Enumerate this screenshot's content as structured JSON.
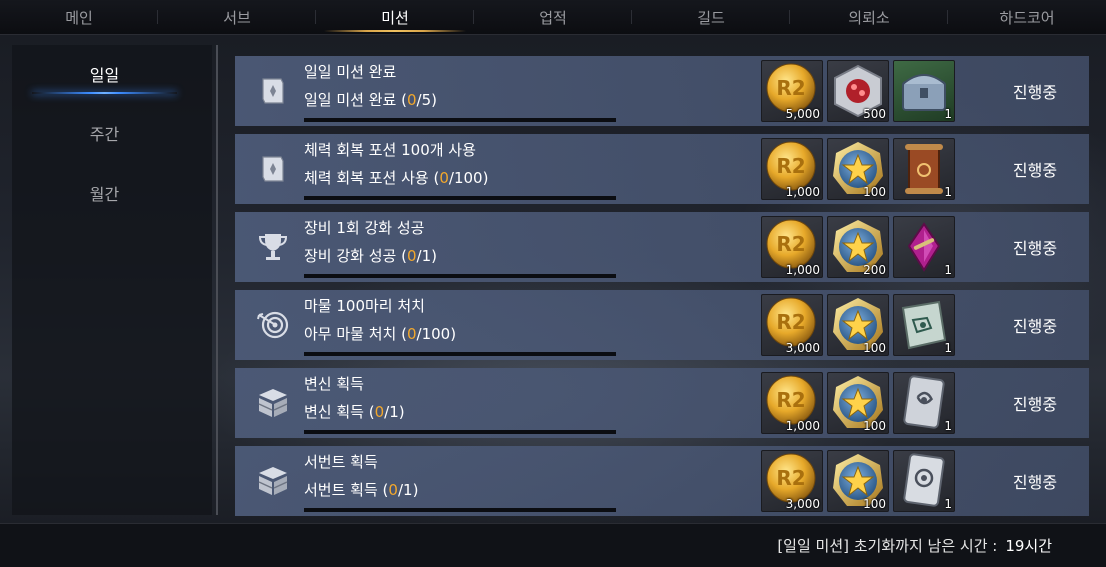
{
  "tabs": [
    {
      "label": "메인",
      "active": false
    },
    {
      "label": "서브",
      "active": false
    },
    {
      "label": "미션",
      "active": true
    },
    {
      "label": "업적",
      "active": false
    },
    {
      "label": "길드",
      "active": false
    },
    {
      "label": "의뢰소",
      "active": false
    },
    {
      "label": "하드코어",
      "active": false
    }
  ],
  "sidebar": {
    "items": [
      {
        "label": "일일",
        "active": true
      },
      {
        "label": "주간",
        "active": false
      },
      {
        "label": "월간",
        "active": false
      }
    ]
  },
  "missions": [
    {
      "icon": "scroll-icon",
      "title": "일일 미션 완료",
      "sub_label": "일일 미션 완료",
      "current": "0",
      "target": "/5",
      "progress": 0,
      "rewards": [
        {
          "icon": "gold-coin-icon",
          "qty": "5,000"
        },
        {
          "icon": "red-gem-icon",
          "qty": "500"
        },
        {
          "icon": "chest-icon",
          "qty": "1"
        }
      ],
      "status": "진행중"
    },
    {
      "icon": "scroll-icon",
      "title": "체력 회복 포션 100개 사용",
      "sub_label": "체력 회복 포션 사용",
      "current": "0",
      "target": "/100",
      "progress": 0,
      "rewards": [
        {
          "icon": "gold-coin-icon",
          "qty": "1,000"
        },
        {
          "icon": "star-medal-icon",
          "qty": "100"
        },
        {
          "icon": "red-scroll-icon",
          "qty": "1"
        }
      ],
      "status": "진행중"
    },
    {
      "icon": "trophy-icon",
      "title": "장비 1회 강화 성공",
      "sub_label": "장비 강화 성공",
      "current": "0",
      "target": "/1",
      "progress": 0,
      "rewards": [
        {
          "icon": "gold-coin-icon",
          "qty": "1,000"
        },
        {
          "icon": "star-medal-icon",
          "qty": "200"
        },
        {
          "icon": "potion-icon",
          "qty": "1"
        }
      ],
      "status": "진행중"
    },
    {
      "icon": "target-icon",
      "title": "마물 100마리 처치",
      "sub_label": "아무 마물 처치",
      "current": "0",
      "target": "/100",
      "progress": 0,
      "rewards": [
        {
          "icon": "gold-coin-icon",
          "qty": "3,000"
        },
        {
          "icon": "star-medal-icon",
          "qty": "100"
        },
        {
          "icon": "map-scroll-icon",
          "qty": "1"
        }
      ],
      "status": "진행중"
    },
    {
      "icon": "box-icon",
      "title": "변신 획득",
      "sub_label": "변신 획득",
      "current": "0",
      "target": "/1",
      "progress": 0,
      "rewards": [
        {
          "icon": "gold-coin-icon",
          "qty": "1,000"
        },
        {
          "icon": "star-medal-icon",
          "qty": "100"
        },
        {
          "icon": "card-icon",
          "qty": "1"
        }
      ],
      "status": "진행중"
    },
    {
      "icon": "box-icon",
      "title": "서번트 획득",
      "sub_label": "서번트 획득",
      "current": "0",
      "target": "/1",
      "progress": 0,
      "rewards": [
        {
          "icon": "gold-coin-icon",
          "qty": "3,000"
        },
        {
          "icon": "star-medal-icon",
          "qty": "100"
        },
        {
          "icon": "card-icon",
          "qty": "1"
        }
      ],
      "status": "진행중"
    }
  ],
  "footer": {
    "label": "[일일 미션] 초기화까지 남은 시간 :",
    "value": "19시간"
  },
  "colors": {
    "accent_gold": "#f3a82c",
    "tab_active_underline": "#d9a54a",
    "side_active_underline": "#3c8cff",
    "row_bg": "#4e5c7a"
  }
}
